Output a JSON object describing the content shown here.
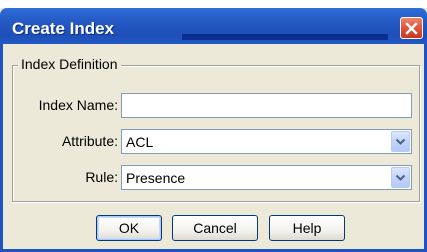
{
  "window": {
    "title": "Create Index",
    "close_icon": "close-icon"
  },
  "group": {
    "legend": "Index Definition"
  },
  "fields": {
    "index_name": {
      "label": "Index Name:",
      "value": ""
    },
    "attribute": {
      "label": "Attribute:",
      "value": "ACL",
      "icon": "chevron-down-icon"
    },
    "rule": {
      "label": "Rule:",
      "value": "Presence",
      "icon": "chevron-down-icon"
    }
  },
  "buttons": {
    "ok": "OK",
    "cancel": "Cancel",
    "help": "Help"
  },
  "colors": {
    "title_bar": "#2458c2",
    "dialog_background": "#ece9d8",
    "close_button": "#e2583e",
    "field_border": "#7f9db9",
    "button_border": "#003c74"
  }
}
